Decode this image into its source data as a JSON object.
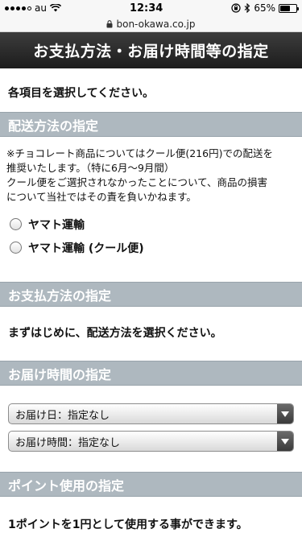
{
  "status_bar": {
    "carrier": "au",
    "time": "12:34",
    "battery_text": "65%",
    "battery_level": 0.65
  },
  "url_bar": {
    "domain": "bon-okawa.co.jp"
  },
  "page": {
    "title": "お支払方法・お届け時間等の指定",
    "intro": "各項目を選択してください。"
  },
  "delivery_method": {
    "header": "配送方法の指定",
    "note_lines": [
      "※チョコレート商品についてはクール便(216円)での配送を",
      "推奨いたします。（特に6月〜9月間）",
      "クール便をご選択されなかったことについて、商品の損害",
      "について当社ではその責を負いかねます。"
    ],
    "options": [
      "ヤマト運輸",
      "ヤマト運輸 (クール便)"
    ]
  },
  "payment": {
    "header": "お支払方法の指定",
    "message": "まずはじめに、配送方法を選択ください。"
  },
  "delivery_time": {
    "header": "お届け時間の指定",
    "date_select": "お届け日：指定なし",
    "time_select": "お届け時間：指定なし"
  },
  "points": {
    "header": "ポイント使用の指定",
    "message": "1ポイントを1円として使用する事ができます。"
  }
}
